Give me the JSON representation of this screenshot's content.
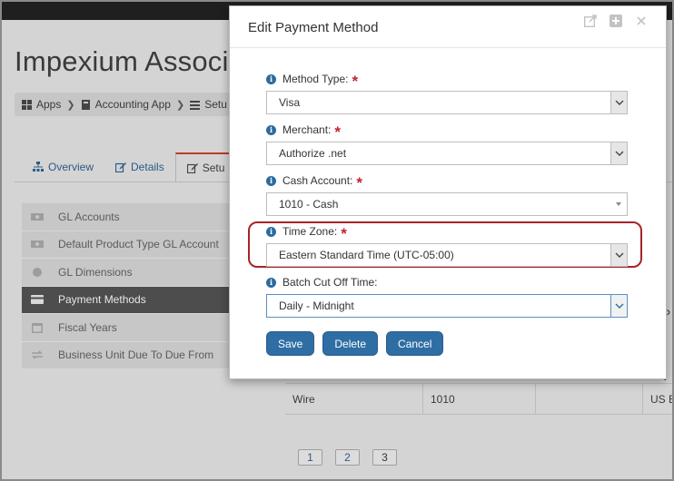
{
  "app": {
    "title": "Impexium Associatio"
  },
  "breadcrumb": {
    "items": [
      {
        "label": "Apps",
        "icon": "apps-grid-icon"
      },
      {
        "label": "Accounting App",
        "icon": "accounting-icon"
      },
      {
        "label": "Setu",
        "icon": "list-icon"
      }
    ]
  },
  "tabs": [
    {
      "label": "Overview",
      "icon": "sitemap-icon"
    },
    {
      "label": "Details",
      "icon": "edit-icon"
    },
    {
      "label": "Setu",
      "icon": "edit-icon"
    }
  ],
  "side_menu": {
    "items": [
      {
        "label": "GL Accounts",
        "icon": "money-icon",
        "active": false
      },
      {
        "label": "Default Product Type GL Account",
        "icon": "money-icon",
        "active": false
      },
      {
        "label": "GL Dimensions",
        "icon": "circle-icon",
        "active": false
      },
      {
        "label": "Payment Methods",
        "icon": "credit-card-icon",
        "active": true
      },
      {
        "label": "Fiscal Years",
        "icon": "calendar-icon",
        "active": false
      },
      {
        "label": "Business Unit Due To Due From",
        "icon": "exchange-icon",
        "active": false
      }
    ]
  },
  "grid": {
    "row": {
      "method": "Wire",
      "account": "1010",
      "col3": "",
      "col4": "US E"
    },
    "right_fragments": [
      "P",
      "t"
    ]
  },
  "pagination": {
    "pages": [
      "1",
      "2",
      "3"
    ],
    "current": "3"
  },
  "modal": {
    "title": "Edit Payment Method",
    "fields": {
      "method_type": {
        "label": "Method Type:",
        "value": "Visa",
        "required": true
      },
      "merchant": {
        "label": "Merchant:",
        "value": "Authorize .net",
        "required": true
      },
      "cash_account": {
        "label": "Cash Account:",
        "value": "1010 - Cash",
        "required": true
      },
      "time_zone": {
        "label": "Time Zone:",
        "value": "Eastern Standard Time (UTC-05:00)",
        "required": true
      },
      "batch_cutoff": {
        "label": "Batch Cut Off Time:",
        "value": "Daily - Midnight",
        "required": false
      }
    },
    "buttons": {
      "save": "Save",
      "delete": "Delete",
      "cancel": "Cancel"
    },
    "required_mark": "*",
    "info_glyph": "i"
  },
  "colors": {
    "primary": "#2f6ea5",
    "required": "#c0272d",
    "highlight": "#a8232b",
    "active_menu": "#4d4d4d"
  }
}
